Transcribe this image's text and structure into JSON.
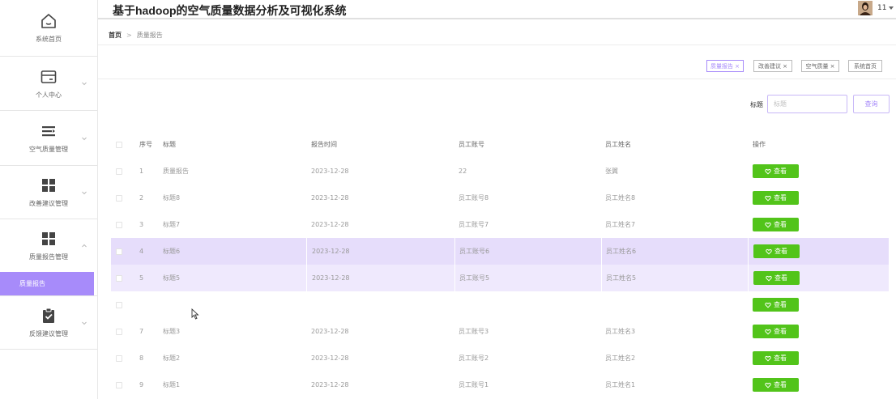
{
  "header": {
    "title": "基于hadoop的空气质量数据分析及可视化系统",
    "user_name": "11"
  },
  "sidebar": {
    "items": [
      {
        "label": "系统首页",
        "icon": "home-icon",
        "has_chevron": false
      },
      {
        "label": "个人中心",
        "icon": "card-icon",
        "has_chevron": true
      },
      {
        "label": "空气质量管理",
        "icon": "list-icon",
        "has_chevron": true
      },
      {
        "label": "改善建议管理",
        "icon": "grid-icon",
        "has_chevron": true
      },
      {
        "label": "质量报告管理",
        "icon": "grid-icon",
        "has_chevron": true,
        "expanded": true
      },
      {
        "label": "反馈建议管理",
        "icon": "clipboard-check-icon",
        "has_chevron": true
      }
    ],
    "sub_item": {
      "label": "质量报告"
    }
  },
  "breadcrumb": {
    "home": "首页",
    "separator": ">",
    "current": "质量报告"
  },
  "tags": [
    {
      "label": "质量报告 ×",
      "active": true
    },
    {
      "label": "改善建议 ×",
      "active": false
    },
    {
      "label": "空气质量 ×",
      "active": false
    },
    {
      "label": "系统首页",
      "active": false
    }
  ],
  "search": {
    "label": "标题",
    "placeholder": "标题",
    "button_label": "查询"
  },
  "table": {
    "columns": [
      "序号",
      "标题",
      "报告时间",
      "员工账号",
      "员工姓名",
      "操作"
    ],
    "action_label": "查看",
    "rows": [
      {
        "idx": "1",
        "title": "质量报告",
        "time": "2023-12-28",
        "account": "22",
        "name": "张翼"
      },
      {
        "idx": "2",
        "title": "标题8",
        "time": "2023-12-28",
        "account": "员工账号8",
        "name": "员工姓名8"
      },
      {
        "idx": "3",
        "title": "标题7",
        "time": "2023-12-28",
        "account": "员工账号7",
        "name": "员工姓名7"
      },
      {
        "idx": "4",
        "title": "标题6",
        "time": "2023-12-28",
        "account": "员工账号6",
        "name": "员工姓名6"
      },
      {
        "idx": "5",
        "title": "标题5",
        "time": "2023-12-28",
        "account": "员工账号5",
        "name": "员工姓名5"
      },
      {
        "idx": "",
        "title": "",
        "time": "",
        "account": "",
        "name": ""
      },
      {
        "idx": "7",
        "title": "标题3",
        "time": "2023-12-28",
        "account": "员工账号3",
        "name": "员工姓名3"
      },
      {
        "idx": "8",
        "title": "标题2",
        "time": "2023-12-28",
        "account": "员工账号2",
        "name": "员工姓名2"
      },
      {
        "idx": "9",
        "title": "标题1",
        "time": "2023-12-28",
        "account": "员工账号1",
        "name": "员工姓名1"
      }
    ]
  },
  "colors": {
    "accent": "#a78bfa",
    "action_button": "#52c41a",
    "row_highlight_strong": "#e6ddfb",
    "row_highlight_light": "#efe9fd"
  }
}
